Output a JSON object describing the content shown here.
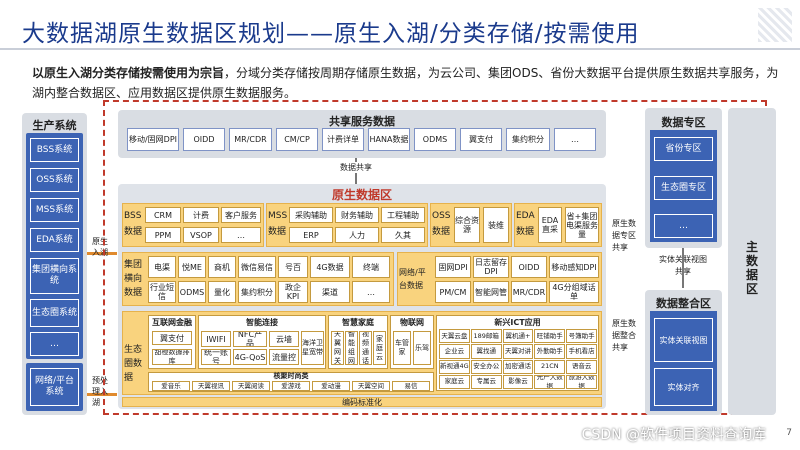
{
  "title": "大数据湖原生数据区规划——原生入湖/分类存储/按需使用",
  "intro": {
    "bold": "以原生入湖分类存储按需使用为宗旨",
    "rest": "，分域分类存储按周期存储原生数据，为云公司、集团ODS、省份大数据平台提供原生数据共享服务，为湖内整合数据区、应用数据区提供原生数据服务。"
  },
  "production": {
    "title": "生产系统",
    "items": [
      "BSS系统",
      "OSS系统",
      "MSS系统",
      "EDA系统",
      "集团横向系统",
      "生态圈系统",
      "…"
    ],
    "network": "网络/平台系统"
  },
  "shared": {
    "title": "共享服务数据",
    "items": [
      "移动/固网DPI",
      "OIDD",
      "MR/CDR",
      "CM/CP",
      "计费详单",
      "HANA数据",
      "ODMS",
      "翼支付",
      "集约积分",
      "…"
    ],
    "share_label": "数据共享"
  },
  "raw": {
    "title": "原生数据区",
    "bss": {
      "label": "BSS数据",
      "items": [
        "CRM",
        "计费",
        "客户服务",
        "PPM",
        "VSOP",
        "…"
      ]
    },
    "mss": {
      "label": "MSS数据",
      "items": [
        "采购辅助",
        "财务辅助",
        "工程辅助",
        "ERP",
        "人力",
        "久其"
      ]
    },
    "oss": {
      "label": "OSS数据",
      "items": [
        "综合资源",
        "装维"
      ]
    },
    "eda": {
      "label": "EDA数据",
      "items": [
        "EDA直采",
        "省+集团电渠服务量"
      ]
    },
    "group": {
      "label": "集团横向数据",
      "items": [
        "电渠",
        "悦ME",
        "商机",
        "微信易信",
        "号百",
        "4G数据",
        "终端",
        "行业短信",
        "ODMS",
        "量化",
        "集约积分",
        "政企KPI",
        "渠道",
        "…"
      ]
    },
    "net": {
      "label": "网络/平台数据",
      "items": [
        "固网DPI",
        "日志留存DPI",
        "OIDD",
        "移动感知DPI",
        "PM/CM",
        "智能网管",
        "MR/CDR",
        "4G分组域话单"
      ]
    },
    "eco": {
      "label": "生态圈数据",
      "finance": {
        "title": "互联网金融",
        "items": [
          "翼支付",
          "甜橙数據排库"
        ]
      },
      "smart": {
        "title": "智能连接",
        "items": [
          "IWIFI",
          "NFC产品",
          "云墙",
          "海洋卫星宽带",
          "统一账号",
          "4G-QoS",
          "流量控"
        ]
      },
      "home": {
        "title": "智慧家庭",
        "items": [
          "天翼网关",
          "智能组网",
          "视频通话",
          "家庭云"
        ]
      },
      "iot": {
        "title": "物联网",
        "items": [
          "车管家",
          "乐驾"
        ]
      },
      "ict": {
        "title": "新兴ICT应用",
        "items": [
          "天翼云盘",
          "189邮箱",
          "翼机通+",
          "旺铺助手",
          "号簿助手",
          "企业云",
          "翼找通",
          "天翼对讲",
          "外勤助手",
          "手机看店",
          "新视通4G",
          "安全办公",
          "加密通话",
          "21CN",
          "语音云",
          "家庭云",
          "专属云",
          "影像云",
          "光产大数据",
          "旅游大数据"
        ]
      },
      "fashion": {
        "title": "核聚时尚类",
        "items": [
          "爱音乐",
          "天翼视讯",
          "天翼阅读",
          "爱游戏",
          "爱动漫",
          "天翼空间",
          "易信"
        ]
      }
    },
    "encoding": "编码标准化"
  },
  "right": {
    "domain_title": "数据专区",
    "domain_items": [
      "省份专区",
      "生态圈专区",
      "…"
    ],
    "share_domain": "原生数据专区共享",
    "entity_label": "实体关联视图共享",
    "integrate_title": "数据整合区",
    "integrate_items": [
      "实体关联视图",
      "实体对齐"
    ],
    "integrate_share": "原生数据整合共享",
    "master": "主数据区"
  },
  "arrows": {
    "ingest": "原生入湖",
    "preprocess": "预处理入湖"
  },
  "watermark": "CSDN @软件项目资料查询库",
  "page": "7"
}
